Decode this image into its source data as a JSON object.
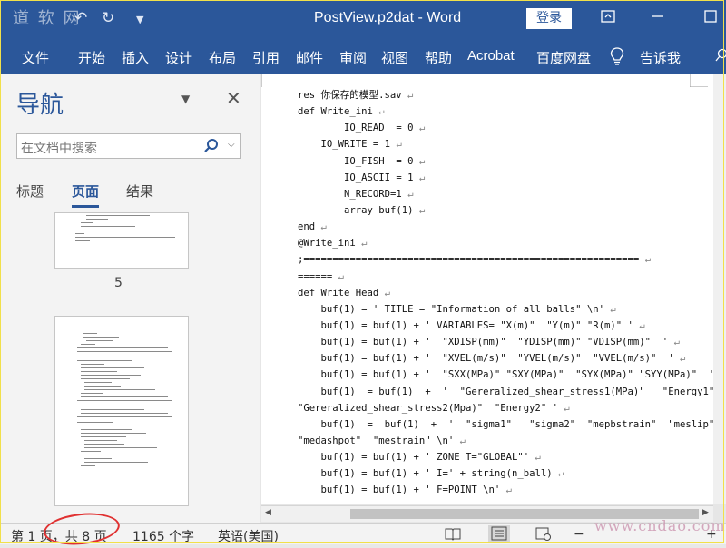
{
  "title_bar": {
    "watermark_left": "道 软 网",
    "document_title": "PostView.p2dat - Word",
    "login_label": "登录",
    "undo_icon": "undo-icon",
    "redo_icon": "redo-icon",
    "customize_icon": "customize-quick-access-icon"
  },
  "ribbon": {
    "tabs": [
      "文件",
      "开始",
      "插入",
      "设计",
      "布局",
      "引用",
      "邮件",
      "审阅",
      "视图",
      "帮助",
      "Acrobat",
      "百度网盘",
      "告诉我"
    ],
    "tell_me_icon": "lightbulb-icon"
  },
  "navigation": {
    "title": "导航",
    "search_placeholder": "在文档中搜索",
    "tabs": [
      "标题",
      "页面",
      "结果"
    ],
    "active_tab": "页面",
    "page_number_visible": "5"
  },
  "document": {
    "lines": [
      "res 你保存的模型.sav",
      "def Write_ini",
      "        IO_READ  = 0",
      "    IO_WRITE = 1",
      "        IO_FISH  = 0",
      "        IO_ASCII = 1",
      "        N_RECORD=1",
      "        array buf(1)",
      "end",
      "@Write_ini",
      ";==========================================================",
      "======",
      "def Write_Head",
      "    buf(1) = ' TITLE = \"Information of all balls\" \\n'",
      "    buf(1) = buf(1) + ' VARIABLES= \"X(m)\"  \"Y(m)\" \"R(m)\" '",
      "    buf(1) = buf(1) + '  \"XDISP(mm)\"  \"YDISP(mm)\" \"VDISP(mm)\"  '",
      "    buf(1) = buf(1) + '  \"XVEL(m/s)\"  \"YVEL(m/s)\"  \"VVEL(m/s)\"  '",
      "    buf(1) = buf(1) + '  \"SXX(MPa)\" \"SXY(MPa)\"  \"SYX(MPa)\" \"SYY(MPa)\"  '",
      "    buf(1)  = buf(1)  +  '  \"Gereralized_shear_stress1(MPa)\"   \"Energy1\"",
      "\"Gereralized_shear_stress2(Mpa)\"  \"Energy2\" '",
      "    buf(1)  =  buf(1)  +  '  \"sigma1\"   \"sigma2\"  \"mepbstrain\"  \"meslip\"",
      "\"medashpot\"  \"mestrain\" \\n'",
      "    buf(1) = buf(1) + ' ZONE T=\"GLOBAL\"'",
      "    buf(1) = buf(1) + ' I=' + string(n_ball)",
      "    buf(1) = buf(1) + ' F=POINT \\n'"
    ]
  },
  "status_bar": {
    "page_info": "第 1 页，共 8 页",
    "word_count": "1165 个字",
    "language": "英语(美国)",
    "zoom_minus": "−",
    "zoom_plus": "+",
    "watermark_right": "www.cndao.com"
  },
  "colors": {
    "ribbon_blue": "#2b579a",
    "annotation_red": "#e03131"
  }
}
